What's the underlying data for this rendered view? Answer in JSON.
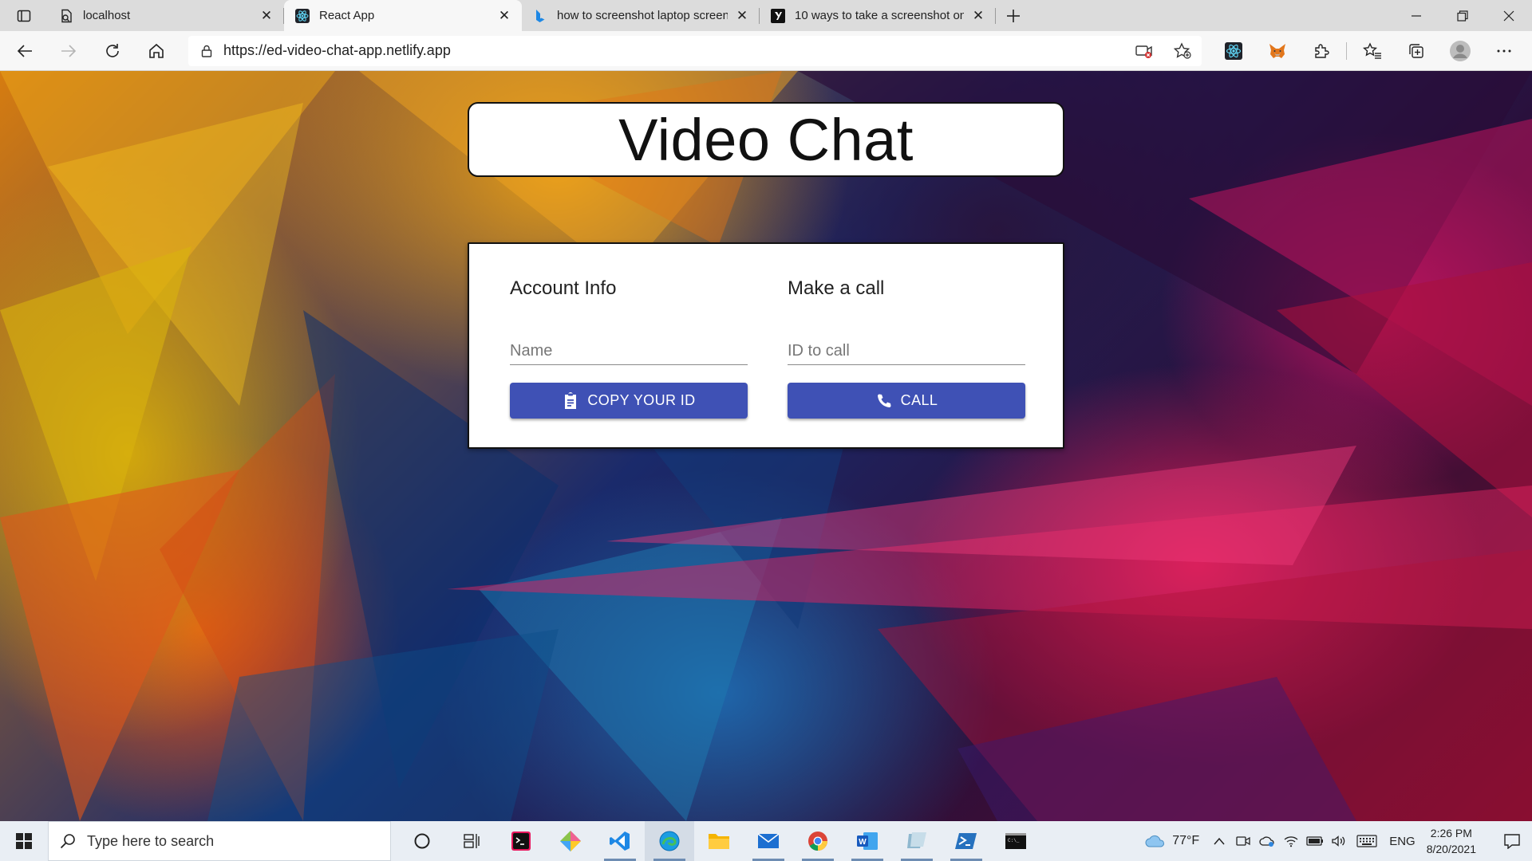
{
  "browser": {
    "tabs": [
      {
        "title": "localhost",
        "active": false
      },
      {
        "title": "React App",
        "active": true
      },
      {
        "title": "how to screenshot laptop screen",
        "active": false
      },
      {
        "title": "10 ways to take a screenshot on",
        "active": false
      }
    ],
    "url": "https://ed-video-chat-app.netlify.app"
  },
  "page": {
    "title": "Video Chat",
    "account": {
      "heading": "Account Info",
      "name_placeholder": "Name",
      "copy_button": "COPY YOUR ID"
    },
    "call": {
      "heading": "Make a call",
      "id_placeholder": "ID to call",
      "call_button": "CALL"
    }
  },
  "taskbar": {
    "search_placeholder": "Type here to search",
    "temperature": "77°F",
    "language": "ENG",
    "time": "2:26 PM",
    "date": "8/20/2021"
  },
  "colors": {
    "primary_button": "#3f51b5",
    "tab_strip": "#dcdcdc",
    "toolbar": "#f7f7f7",
    "taskbar": "#e9eef4"
  }
}
